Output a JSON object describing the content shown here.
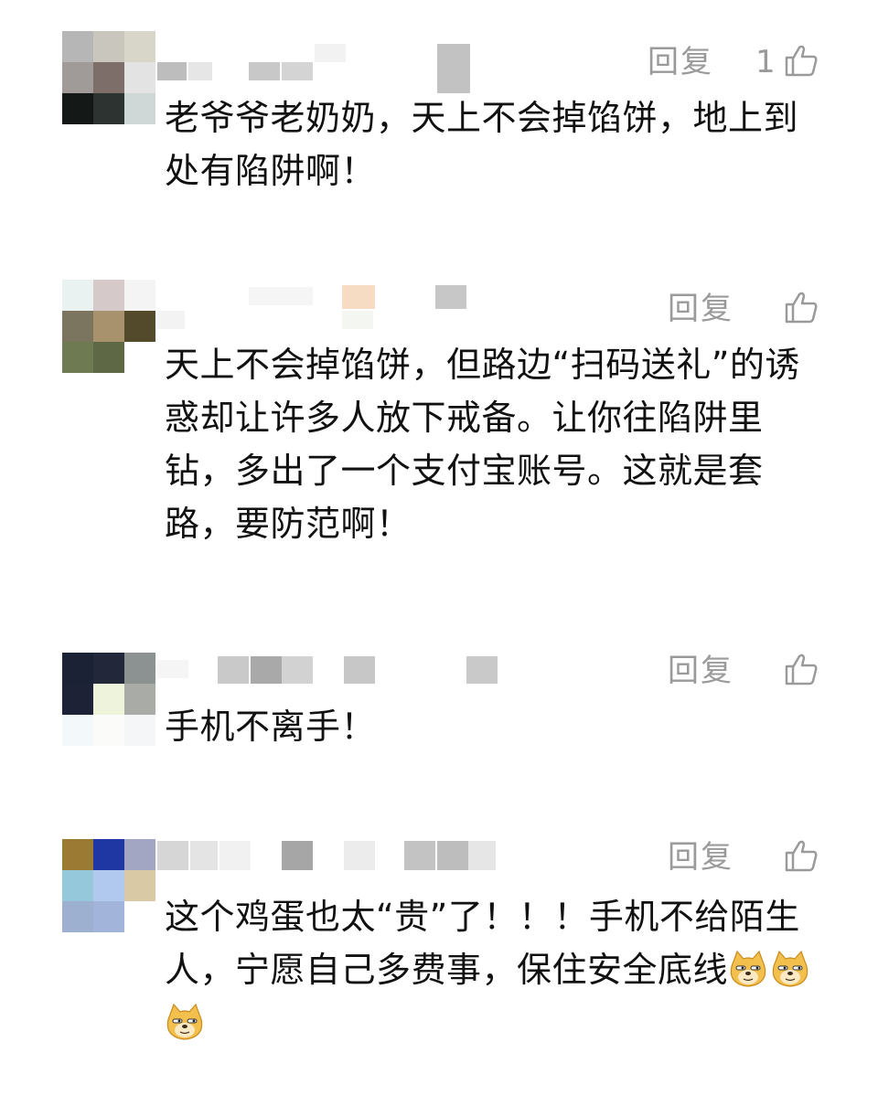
{
  "comments": [
    {
      "reply_label": "回复",
      "like_count": "1",
      "text": "老爷爷老奶奶，天上不会掉馅饼，地上到处有陷阱啊！",
      "avatar_colors": [
        "#b6b6b6",
        "#c9c6bd",
        "#d8d6c8",
        "#a09a98",
        "#7d6e6a",
        "#e3e3e3",
        "#141817",
        "#2c3331",
        "#cfd7d7"
      ]
    },
    {
      "reply_label": "回复",
      "like_count": "",
      "text": "天上不会掉馅饼，但路边“扫码送礼”的诱惑却让许多人放下戒备。让你往陷阱里钻，多出了一个支付宝账号。这就是套路，要防范啊！",
      "avatar_colors": [
        "#e9f2f0",
        "#d6c9c9",
        "#f4f4f4",
        "#7b745f",
        "#a7926d",
        "#534a2b",
        "#6e7a52",
        "#5f6845",
        "#ffffff"
      ]
    },
    {
      "reply_label": "回复",
      "like_count": "",
      "text": "手机不离手！",
      "avatar_colors": [
        "#1c2236",
        "#22283a",
        "#8c9192",
        "#1d2236",
        "#eef3dc",
        "#a8aba6",
        "#f3f8fb",
        "#fbfbf9",
        "#f4f6f7"
      ]
    },
    {
      "reply_label": "回复",
      "like_count": "",
      "text": "这个鸡蛋也太“贵”了！！！手机不给陌生人，宁愿自己多费事，保住安全底线",
      "emoji_count": 3,
      "avatar_colors": [
        "#9b7a33",
        "#1f37a3",
        "#a3a6c3",
        "#95c8da",
        "#b2c9ef",
        "#d9c9a5",
        "#9eb0cf",
        "#a2b4d9",
        "#ffffff"
      ]
    }
  ]
}
